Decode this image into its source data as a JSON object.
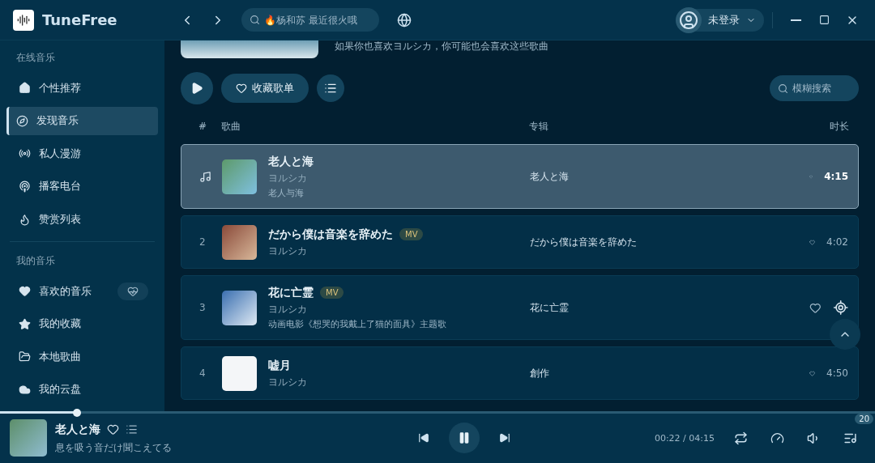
{
  "app": {
    "title": "TuneFree"
  },
  "search": {
    "placeholder": "🔥杨和苏 最近很火哦"
  },
  "user": {
    "label": "未登录"
  },
  "sidebar": {
    "sections": [
      {
        "title": "在线音乐",
        "items": [
          {
            "label": "个性推荐",
            "selected": false
          },
          {
            "label": "发现音乐",
            "selected": true
          },
          {
            "label": "私人漫游",
            "selected": false
          },
          {
            "label": "播客电台",
            "selected": false
          },
          {
            "label": "赞赏列表",
            "selected": false
          }
        ]
      },
      {
        "title": "我的音乐",
        "items": [
          {
            "label": "喜欢的音乐",
            "selected": false,
            "action": true
          },
          {
            "label": "我的收藏",
            "selected": false,
            "action": false
          },
          {
            "label": "本地歌曲",
            "selected": false,
            "action": false
          },
          {
            "label": "我的云盘",
            "selected": false,
            "action": false
          }
        ]
      }
    ]
  },
  "banner": {
    "description": "如果你也喜欢ヨルシカ，你可能也会喜欢这些歌曲"
  },
  "toolbar": {
    "collect": "收藏歌单",
    "filter_placeholder": "模糊搜索"
  },
  "table": {
    "columns": [
      "#",
      "歌曲",
      "专辑",
      "时长"
    ],
    "rows": [
      {
        "title": "老人と海",
        "artist": "ヨルシカ",
        "note": "老人与海",
        "album": "老人と海",
        "duration": "4:15",
        "selected": true
      },
      {
        "number": "2",
        "title": "だから僕は音楽を辞めた",
        "badge": "MV",
        "artist": "ヨルシカ",
        "album": "だから僕は音楽を辞めた",
        "duration": "4:02",
        "selected": false
      },
      {
        "number": "3",
        "title": "花に亡霊",
        "badge": "MV",
        "artist": "ヨルシカ",
        "note": "动画电影《想哭的我戴上了猫的面具》主题歌",
        "album": "花に亡霊",
        "selected": false
      },
      {
        "number": "4",
        "title": "嘘月",
        "artist": "ヨルシカ",
        "album": "創作",
        "duration": "4:50",
        "selected": false
      }
    ]
  },
  "player": {
    "title": "老人と海",
    "lyric": "息を吸う音だけ聞こえてる",
    "time": "00:22 / 04:15",
    "playing": true,
    "level": 0.088,
    "queue_count": "20"
  }
}
